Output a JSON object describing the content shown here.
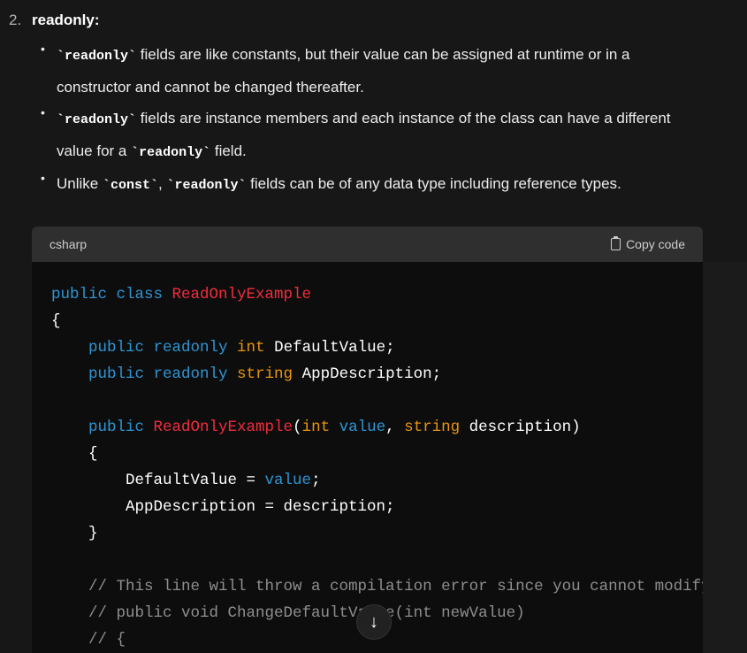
{
  "list_number": "2.",
  "heading": "readonly:",
  "bullets": [
    {
      "code": "`readonly`",
      "text": " fields are like constants, but their value can be assigned at runtime or in a constructor and cannot be changed thereafter."
    },
    {
      "code": "`readonly`",
      "text": " fields are instance members and each instance of the class can have a different value for a ",
      "code2": "`readonly`",
      "text2": " field."
    },
    {
      "pre": "Unlike ",
      "code": "`const`",
      "mid": ", ",
      "code2": "`readonly`",
      "text2": " fields can be of any data type including reference types."
    }
  ],
  "code_block": {
    "language": "csharp",
    "copy_label": "Copy code",
    "lines": [
      [
        [
          "k",
          "public class "
        ],
        [
          "c",
          "ReadOnlyExample"
        ]
      ],
      [
        [
          "",
          "{"
        ]
      ],
      [
        [
          "",
          "    "
        ],
        [
          "k",
          "public readonly "
        ],
        [
          "t",
          "int "
        ],
        [
          "",
          "DefaultValue;"
        ]
      ],
      [
        [
          "",
          "    "
        ],
        [
          "k",
          "public readonly "
        ],
        [
          "t",
          "string "
        ],
        [
          "",
          "AppDescription;"
        ]
      ],
      [
        [
          "",
          ""
        ]
      ],
      [
        [
          "",
          "    "
        ],
        [
          "k",
          "public "
        ],
        [
          "c",
          "ReadOnlyExample"
        ],
        [
          "",
          "("
        ],
        [
          "t",
          "int "
        ],
        [
          "k",
          "value"
        ],
        [
          "",
          ", "
        ],
        [
          "t",
          "string "
        ],
        [
          "",
          "description)"
        ]
      ],
      [
        [
          "",
          "    {"
        ]
      ],
      [
        [
          "",
          "        DefaultValue = "
        ],
        [
          "k",
          "value"
        ],
        [
          "",
          ";"
        ]
      ],
      [
        [
          "",
          "        AppDescription = description;"
        ]
      ],
      [
        [
          "",
          "    }"
        ]
      ],
      [
        [
          "",
          ""
        ]
      ],
      [
        [
          "m",
          "    // This line will throw a compilation error since you cannot modify a readonly field"
        ]
      ],
      [
        [
          "m",
          "    // public void ChangeDefaultValue(int newValue)"
        ]
      ],
      [
        [
          "m",
          "    // {"
        ]
      ]
    ]
  },
  "scroll_down_icon": "arrow-down-icon"
}
